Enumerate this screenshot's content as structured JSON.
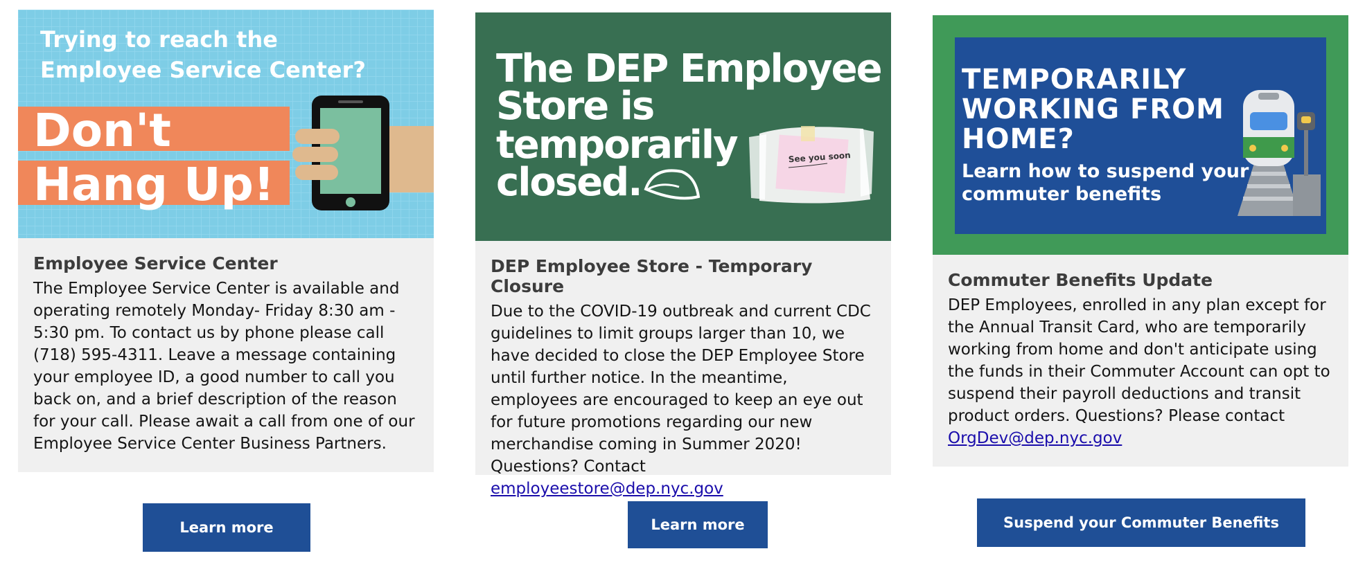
{
  "cards": [
    {
      "banner": {
        "line1": "Trying to reach the",
        "line2": "Employee Service Center?",
        "big1": "Don't",
        "big2": "Hang Up!"
      },
      "title": "Employee Service Center",
      "body": "The Employee Service Center is available and operating remotely Monday- Friday 8:30 am - 5:30 pm. To contact us by phone please call (718) 595-4311. Leave a message containing your employee ID, a good number to call you back on, and a brief description of the reason for your call. Please await a call from one of our Employee Service Center Business Partners.",
      "button": "Learn more"
    },
    {
      "banner": {
        "line1": "The DEP Employee",
        "line2": "Store is",
        "line3": "temporarily",
        "line4": "closed.",
        "note": "See you soon"
      },
      "title": "DEP Employee Store - Temporary Closure",
      "body": "Due to the COVID-19 outbreak and current CDC guidelines to limit groups larger than 10, we have decided to close the DEP Employee Store until further notice. In the meantime, employees are encouraged to keep an eye out for future promotions regarding our new merchandise coming in Summer 2020! Questions? Contact",
      "link": "employeestore@dep.nyc.gov",
      "button": "Learn more"
    },
    {
      "banner": {
        "line1": "TEMPORARILY",
        "line2": "WORKING FROM",
        "line3": "HOME?",
        "sub1": "Learn how to suspend your",
        "sub2": "commuter benefits"
      },
      "title": "Commuter Benefits Update",
      "body": "DEP Employees, enrolled in any plan except for the Annual Transit Card, who are temporarily working from home and don't anticipate using the funds in their Commuter Account can opt to suspend their payroll deductions and transit product orders. Questions? Please contact",
      "link": "OrgDev@dep.nyc.gov",
      "button": "Suspend your Commuter Benefits"
    }
  ],
  "colors": {
    "button_bg": "#1f4f96",
    "panel_bg": "#f0f0f0",
    "banner1_bg": "#7ecde6",
    "banner1_accent": "#f0875a",
    "banner2_bg": "#386f52",
    "banner3_frame": "#409a58",
    "banner3_bg": "#1f4f98"
  }
}
